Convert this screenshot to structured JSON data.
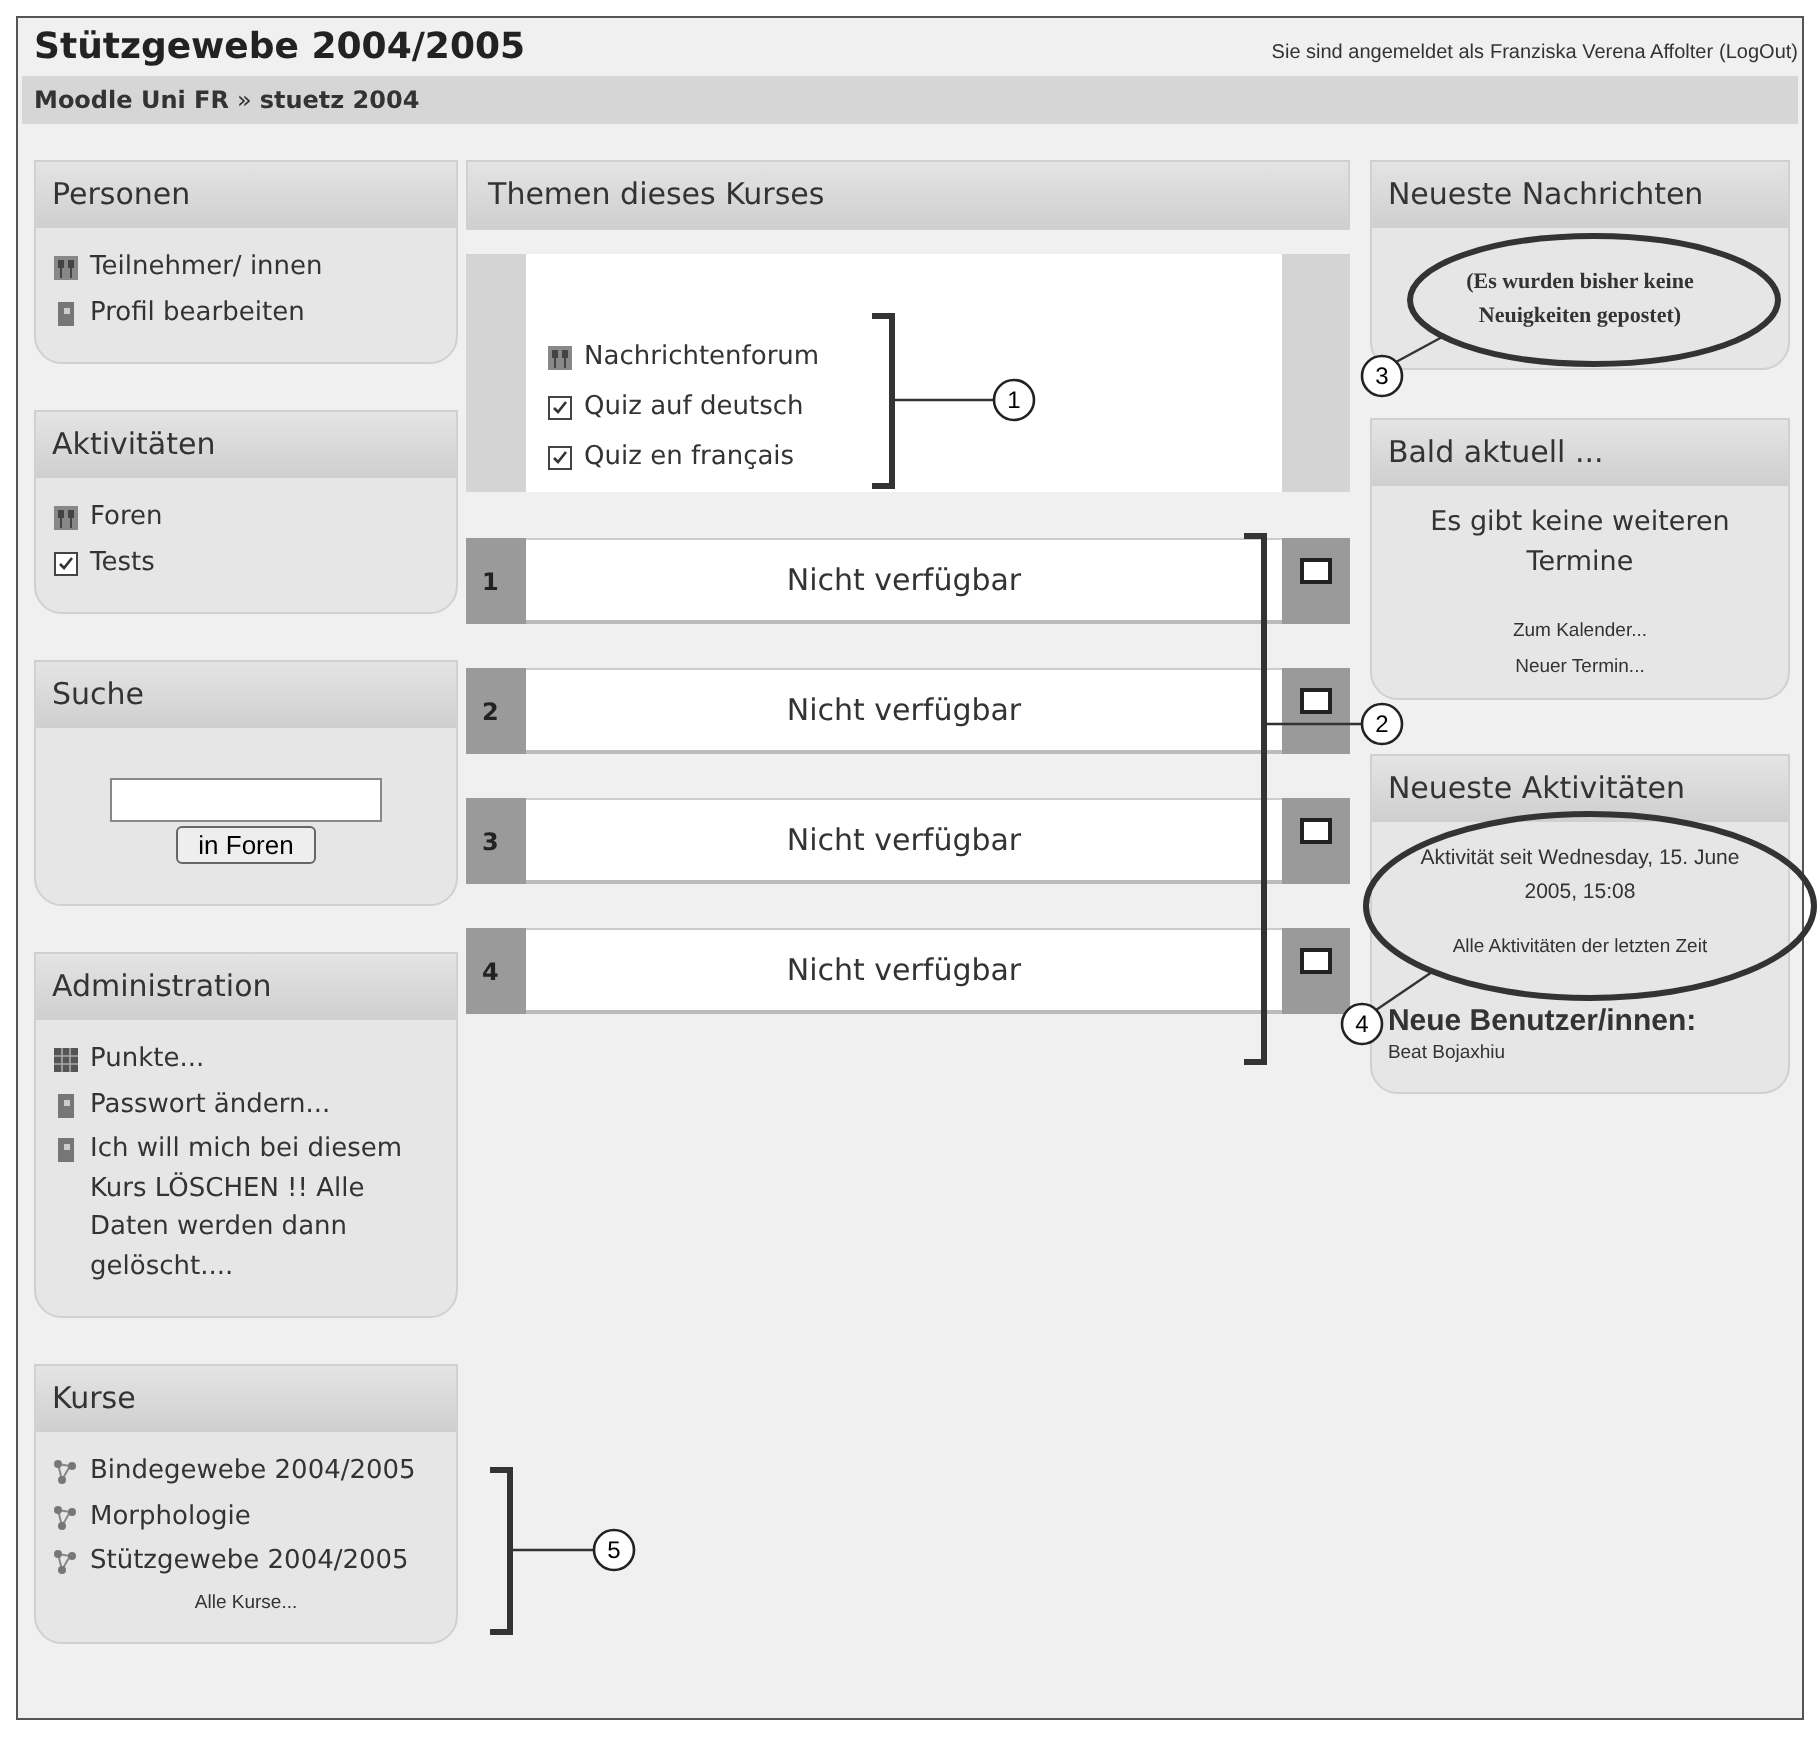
{
  "header": {
    "title": "Stützgewebe 2004/2005",
    "login_text": "Sie sind angemeldet als",
    "user": "Franziska Verena Affolter",
    "logout": "(LogOut)"
  },
  "breadcrumb": {
    "items": [
      "Moodle Uni FR",
      "stuetz 2004"
    ],
    "separator": "»"
  },
  "left_blocks": [
    {
      "kind": "links",
      "title": "Personen",
      "items": [
        {
          "kind": "people",
          "label": "Teilnehmer/ innen"
        },
        {
          "kind": "person",
          "label": "Profil bearbeiten"
        }
      ]
    },
    {
      "kind": "links",
      "title": "Aktivitäten",
      "items": [
        {
          "kind": "people",
          "label": "Foren"
        },
        {
          "kind": "quiz",
          "label": "Tests"
        }
      ]
    },
    {
      "kind": "search",
      "title": "Suche",
      "button": "in Foren"
    },
    {
      "kind": "links",
      "title": "Administration",
      "items": [
        {
          "kind": "grid",
          "label": "Punkte..."
        },
        {
          "kind": "person",
          "label": "Passwort ändern..."
        },
        {
          "kind": "person",
          "label": "Ich will mich bei diesem Kurs LÖSCHEN !! Alle Daten werden dann gelöscht...."
        }
      ]
    },
    {
      "kind": "links",
      "title": "Kurse",
      "items": [
        {
          "kind": "course",
          "label": "Bindegewebe 2004/2005"
        },
        {
          "kind": "course",
          "label": "Morphologie"
        },
        {
          "kind": "course",
          "label": "Stützgewebe 2004/2005"
        }
      ],
      "footer": "Alle Kurse..."
    }
  ],
  "topics": {
    "title": "Themen dieses Kurses",
    "general": [
      {
        "kind": "people",
        "label": "Nachrichtenforum"
      },
      {
        "kind": "quiz",
        "label": "Quiz auf deutsch"
      },
      {
        "kind": "quiz",
        "label": "Quiz en français"
      }
    ],
    "sections": [
      {
        "number": "1",
        "text": "Nicht verfügbar"
      },
      {
        "number": "2",
        "text": "Nicht verfügbar"
      },
      {
        "number": "3",
        "text": "Nicht verfügbar"
      },
      {
        "number": "4",
        "text": "Nicht verfügbar"
      }
    ]
  },
  "news": {
    "title": "Neueste Nachrichten",
    "text": "(Es wurden bisher keine Neuigkeiten gepostet)"
  },
  "calendar": {
    "title": "Bald aktuell ...",
    "text": "Es gibt keine weiteren Termine",
    "links": [
      "Zum Kalender...",
      "Neuer Termin..."
    ]
  },
  "activity": {
    "title": "Neueste Aktivitäten",
    "since": "Aktivität seit Wednesday, 15. June 2005, 15:08",
    "link": "Alle Aktivitäten der letzten Zeit",
    "new_users_heading": "Neue Benutzer/innen:",
    "users": [
      "Beat Bojaxhiu"
    ]
  },
  "callouts": [
    {
      "number": "1",
      "kind": "bracket"
    },
    {
      "number": "3",
      "kind": "ellipse"
    },
    {
      "number": "2",
      "kind": "bracket"
    },
    {
      "number": "4",
      "kind": "ellipse"
    },
    {
      "number": "5",
      "kind": "bracket"
    }
  ]
}
